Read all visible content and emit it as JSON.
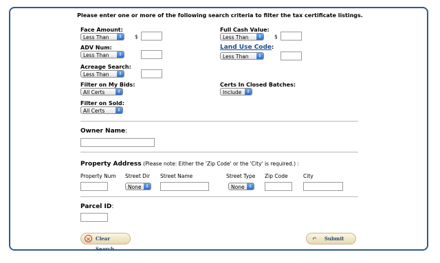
{
  "instructions": "Please enter one or more of the following search criteria to filter the tax certificate listings.",
  "face_amount": {
    "label": "Face Amount:",
    "select": "Less Than",
    "currency": "$",
    "value": ""
  },
  "full_cash_value": {
    "label": "Full Cash Value:",
    "select": "Less Than",
    "currency": "$",
    "value": ""
  },
  "adv_num": {
    "label": "ADV Num:",
    "select": "Less Than",
    "value": ""
  },
  "land_use_code": {
    "label": "Land Use Code",
    "colon": ":",
    "select": "Less Than",
    "value": ""
  },
  "acreage": {
    "label": "Acreage Search:",
    "select": "Less Than",
    "value": ""
  },
  "filter_bids": {
    "label": "Filter on My Bids:",
    "select": "All Certs"
  },
  "closed_batches": {
    "label": "Certs In Closed Batches:",
    "select": "Include"
  },
  "filter_sold": {
    "label": "Filter on Sold:",
    "select": "All Certs"
  },
  "owner": {
    "label": "Owner Name",
    "colon": ":",
    "value": ""
  },
  "address": {
    "label": "Property Address",
    "note": "(Please note: Either the 'Zip Code' or the 'City' is required.) :",
    "cols": {
      "num": "Property Num",
      "dir": "Street Dir",
      "name": "Street Name",
      "type": "Street Type",
      "zip": "Zip Code",
      "city": "City"
    },
    "dir_select": "None",
    "type_select": "None"
  },
  "parcel": {
    "label": "Parcel ID",
    "colon": ":",
    "value": ""
  },
  "buttons": {
    "clear": "Clear Search",
    "submit": "Submit"
  },
  "colors": {
    "border": "#2e5a8a",
    "link": "#1a4a8a",
    "select_arrow": "#2f6cc9"
  }
}
